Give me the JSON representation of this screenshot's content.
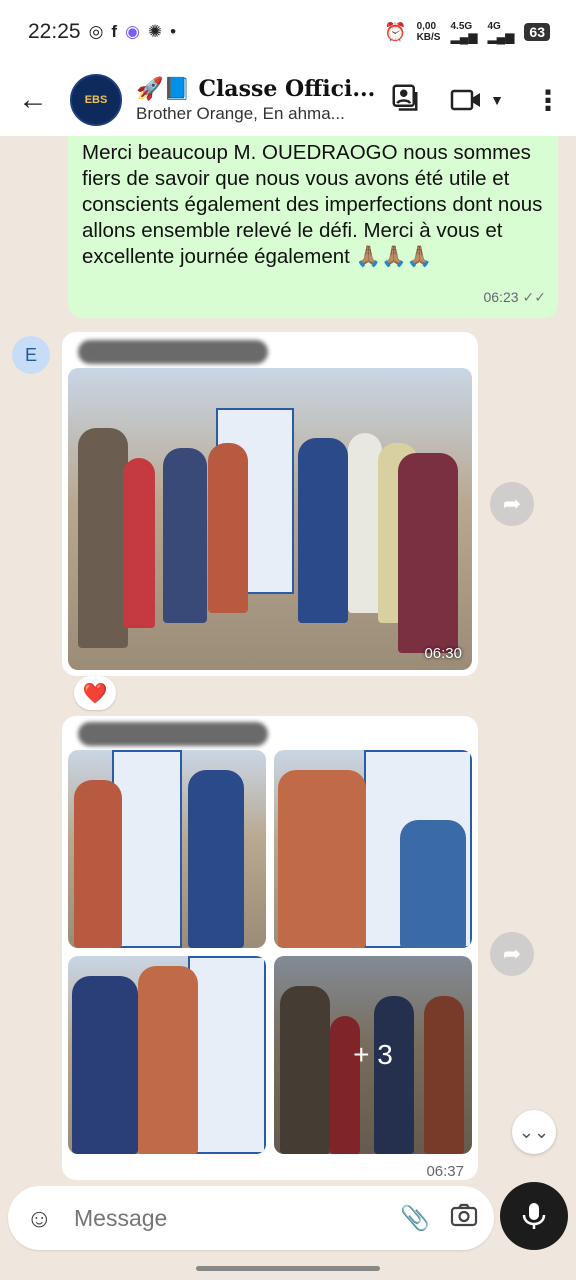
{
  "status": {
    "time": "22:25",
    "net_speed": "0,00",
    "net_unit": "KB/S",
    "net1": "4.5G",
    "net2": "4G",
    "battery": "63"
  },
  "header": {
    "title": "🚀📘 Classe Offici...",
    "subtitle": "Brother Orange, En ahma...",
    "avatar_text": "EBS"
  },
  "messages": {
    "outgoing_text": "Merci beaucoup M. OUEDRAOGO nous sommes fiers de savoir que nous vous avons été utile et conscients également des imperfections dont nous allons ensemble relevé le défi. Merci à vous et excellente journée également 🙏🏽🙏🏽🙏🏽",
    "outgoing_time": "06:23",
    "sender_initial": "E",
    "photo_time": "06:30",
    "reaction": "❤️",
    "album_time": "06:37",
    "album_more": "+ 3"
  },
  "input": {
    "placeholder": "Message"
  },
  "icons": {
    "back": "back-arrow-icon",
    "contact_card": "contact-card-icon",
    "video": "video-call-icon",
    "menu": "more-vert-icon",
    "forward": "forward-icon",
    "emoji": "emoji-icon",
    "attach": "attach-icon",
    "camera": "camera-icon",
    "mic": "mic-icon"
  },
  "colors": {
    "outgoing_bubble": "#d9fdd3",
    "chat_bg": "#efe7de",
    "mic_button": "#1c1c1c"
  }
}
